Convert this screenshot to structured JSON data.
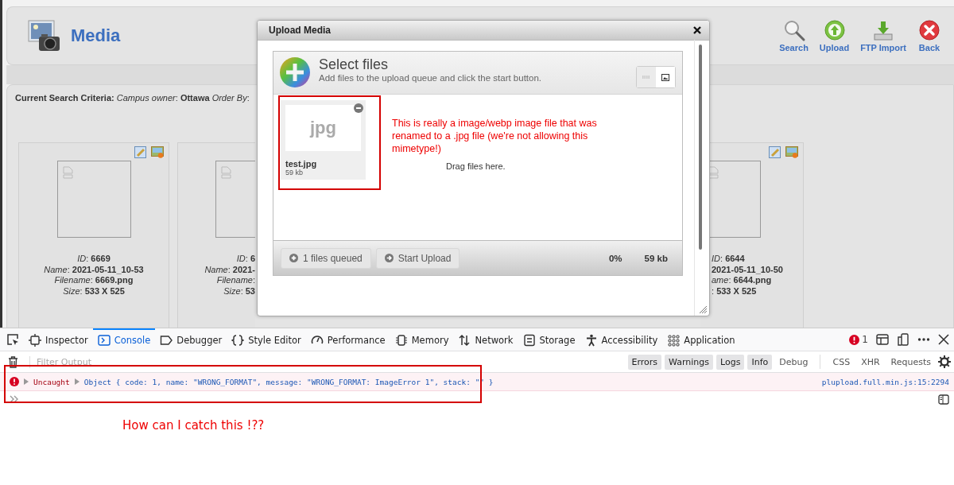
{
  "page": {
    "title": "Media",
    "toolbar": [
      {
        "label": "Search",
        "kind": "search"
      },
      {
        "label": "Upload",
        "kind": "upload"
      },
      {
        "label": "FTP Import",
        "kind": "import"
      },
      {
        "label": "Back",
        "kind": "back"
      }
    ],
    "criteria": "**Current Search Criteria:** *Campus owner*: **Ottawa** *Order By*:",
    "cards": [
      {
        "kind": "full",
        "lines": [
          "*ID*: **6669**",
          "*Name*: **2021-05-11_10-53**",
          "*Filename*: **6669.png**",
          "*Size*: **533 X 525**"
        ]
      },
      {
        "kind": "cut_right",
        "lines": [
          "*ID*: **6**",
          "*Name*: **2021-**",
          "*Filename*:",
          "*Size*: **53**"
        ]
      },
      {
        "kind": "cut_left",
        "lines": [
          "*ID*: **6644**",
          "**2021-05-11_10-50**",
          "*ame*: **6644.png**",
          ": **533 X 525**"
        ]
      }
    ]
  },
  "modal": {
    "title": "Upload Media",
    "uploader": {
      "heading": "Select files",
      "subtitle": "Add files to the upload queue and click the start button.",
      "view_modes": [
        {
          "kind": "list",
          "selected": false
        },
        {
          "kind": "thumbs",
          "selected": true
        }
      ],
      "files": [
        {
          "ext": "jpg",
          "name": "test.jpg",
          "size": "59 kb"
        }
      ],
      "drop_hint": "Drag files here.",
      "buttons": [
        {
          "label": "1 files queued",
          "kind": "add"
        },
        {
          "label": "Start Upload",
          "kind": "start"
        }
      ],
      "percent": "0%",
      "total": "59 kb"
    }
  },
  "annotations": {
    "file_note": "This is really a image/webp image file that was renamed to a .jpg file (we're not allowing this mimetype!)",
    "question": "How can I catch this !??"
  },
  "devtools": {
    "tabs": [
      {
        "label": "Inspector",
        "kind": "inspector",
        "selected": false
      },
      {
        "label": "Console",
        "kind": "console",
        "selected": true
      },
      {
        "label": "Debugger",
        "kind": "debugger",
        "selected": false
      },
      {
        "label": "Style Editor",
        "kind": "style",
        "selected": false
      },
      {
        "label": "Performance",
        "kind": "performance",
        "selected": false
      },
      {
        "label": "Memory",
        "kind": "memory",
        "selected": false
      },
      {
        "label": "Network",
        "kind": "network",
        "selected": false
      },
      {
        "label": "Storage",
        "kind": "storage",
        "selected": false
      },
      {
        "label": "Accessibility",
        "kind": "accessibility",
        "selected": false
      },
      {
        "label": "Application",
        "kind": "application",
        "selected": false
      }
    ],
    "error_count": "1",
    "filter_placeholder": "Filter Output",
    "filters": [
      {
        "label": "Errors",
        "selected": true
      },
      {
        "label": "Warnings",
        "selected": true
      },
      {
        "label": "Logs",
        "selected": true
      },
      {
        "label": "Info",
        "selected": true
      },
      {
        "label": "Debug",
        "selected": false
      },
      {
        "label": "CSS",
        "selected": false
      },
      {
        "label": "XHR",
        "selected": false
      },
      {
        "label": "Requests",
        "selected": false
      }
    ],
    "messages": [
      {
        "kind": "error",
        "prefix": "Uncaught",
        "text": "Object { code: 1, name: \"WRONG_FORMAT\", message: \"WRONG_FORMAT: ImageError 1\", stack: \"\" }",
        "source": "plupload.full.min.js:15:2294"
      }
    ]
  }
}
